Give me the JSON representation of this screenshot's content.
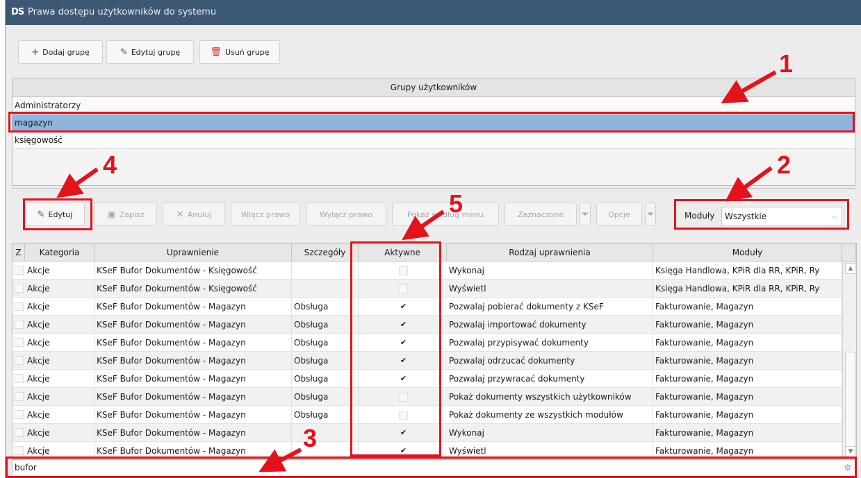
{
  "window": {
    "logo": "DS",
    "title": "Prawa dostępu użytkowników do systemu"
  },
  "top_toolbar": {
    "add_group": "Dodaj grupę",
    "edit_group": "Edytuj grupę",
    "delete_group": "Usuń grupę"
  },
  "groups": {
    "header": "Grupy użytkowników",
    "items": [
      "Administratorzy",
      "magazyn",
      "księgowość"
    ],
    "selected": "magazyn"
  },
  "perm_toolbar": {
    "edit": "Edytuj",
    "save": "Zapisz",
    "cancel": "Anuluj",
    "enable": "Włącz prawo",
    "disable": "Wyłącz prawo",
    "by_menu": "Pokaż według menu",
    "selected": "Zaznaczone",
    "options": "Opcje",
    "modules_label": "Moduły",
    "modules_value": "Wszystkie"
  },
  "grid": {
    "columns": [
      "Z",
      "Kategoria",
      "Uprawnienie",
      "Szczegóły",
      "Aktywne",
      "Rodzaj uprawnienia",
      "Moduły"
    ],
    "rows": [
      {
        "cat": "Akcje",
        "perm": "KSeF Bufor Dokumentów - Księgowość",
        "det": "",
        "active": false,
        "kind": "Wykonaj",
        "mods": "Księga Handlowa, KPiR dla RR, KPiR, Ry"
      },
      {
        "cat": "Akcje",
        "perm": "KSeF Bufor Dokumentów - Księgowość",
        "det": "",
        "active": false,
        "kind": "Wyświetl",
        "mods": "Księga Handlowa, KPiR dla RR, KPiR, Ry"
      },
      {
        "cat": "Akcje",
        "perm": "KSeF Bufor Dokumentów - Magazyn",
        "det": "Obsługa",
        "active": true,
        "kind": "Pozwalaj pobierać dokumenty z KSeF",
        "mods": "Fakturowanie, Magazyn"
      },
      {
        "cat": "Akcje",
        "perm": "KSeF Bufor Dokumentów - Magazyn",
        "det": "Obsługa",
        "active": true,
        "kind": "Pozwalaj importować dokumenty",
        "mods": "Fakturowanie, Magazyn"
      },
      {
        "cat": "Akcje",
        "perm": "KSeF Bufor Dokumentów - Magazyn",
        "det": "Obsługa",
        "active": true,
        "kind": "Pozwalaj przypisywać dokumenty",
        "mods": "Fakturowanie, Magazyn"
      },
      {
        "cat": "Akcje",
        "perm": "KSeF Bufor Dokumentów - Magazyn",
        "det": "Obsługa",
        "active": true,
        "kind": "Pozwalaj odrzucać dokumenty",
        "mods": "Fakturowanie, Magazyn"
      },
      {
        "cat": "Akcje",
        "perm": "KSeF Bufor Dokumentów - Magazyn",
        "det": "Obsługa",
        "active": true,
        "kind": "Pozwalaj przywracać dokumenty",
        "mods": "Fakturowanie, Magazyn"
      },
      {
        "cat": "Akcje",
        "perm": "KSeF Bufor Dokumentów - Magazyn",
        "det": "Obsługa",
        "active": false,
        "kind": "Pokaż dokumenty wszystkich użytkowników",
        "mods": "Fakturowanie, Magazyn"
      },
      {
        "cat": "Akcje",
        "perm": "KSeF Bufor Dokumentów - Magazyn",
        "det": "Obsługa",
        "active": false,
        "kind": "Pokaż dokumenty ze wszystkich modułów",
        "mods": "Fakturowanie, Magazyn"
      },
      {
        "cat": "Akcje",
        "perm": "KSeF Bufor Dokumentów - Magazyn",
        "det": "",
        "active": true,
        "kind": "Wykonaj",
        "mods": "Fakturowanie, Magazyn"
      },
      {
        "cat": "Akcje",
        "perm": "KSeF Bufor Dokumentów - Magazyn",
        "det": "",
        "active": true,
        "kind": "Wyświetl",
        "mods": "Fakturowanie, Magazyn"
      }
    ]
  },
  "search": {
    "value": "bufor"
  },
  "annotations": [
    "1",
    "2",
    "3",
    "4",
    "5"
  ],
  "colors": {
    "annotation": "#e3121b",
    "title_bar": "#3d5873",
    "selected_row": "#8fb4dd"
  }
}
